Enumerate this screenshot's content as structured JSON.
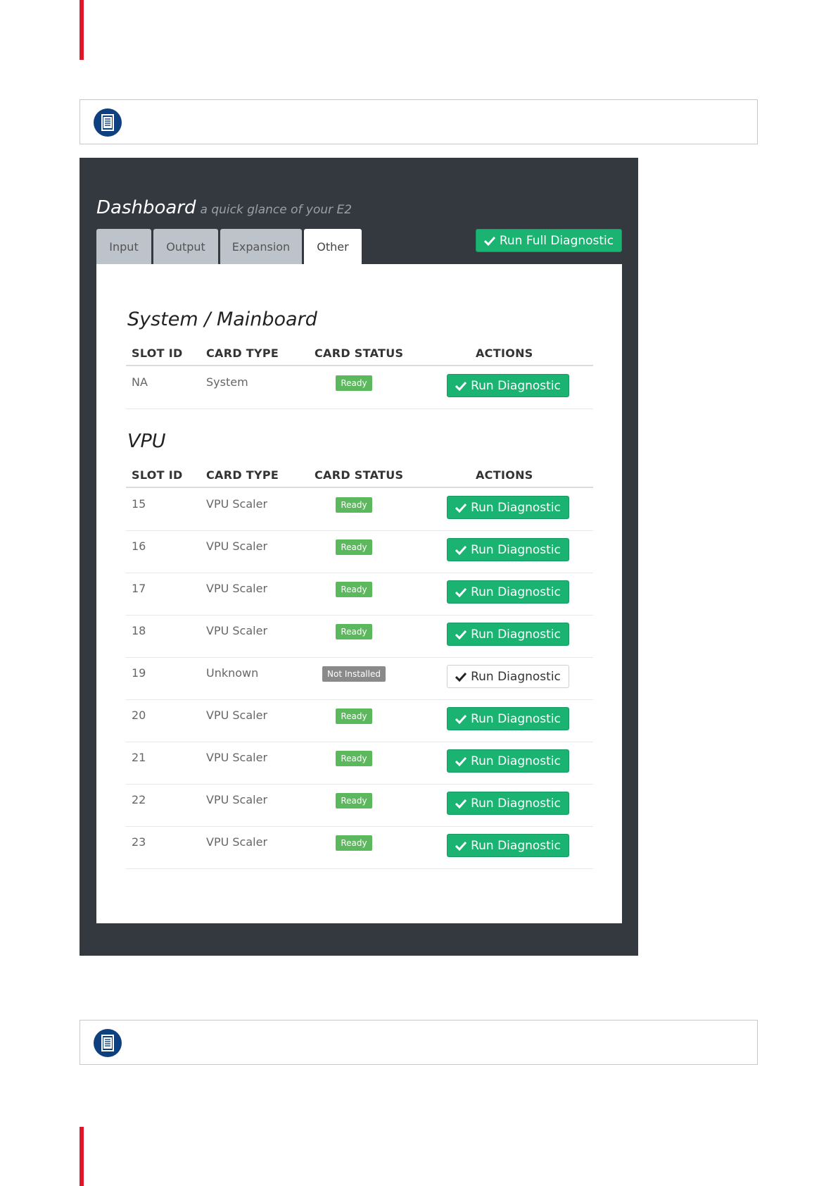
{
  "dashboard": {
    "title": "Dashboard",
    "subtitle": "a quick glance of your E2",
    "tabs": [
      "Input",
      "Output",
      "Expansion",
      "Other"
    ],
    "active_tab": "Other",
    "full_diagnostic_label": "Run Full Diagnostic"
  },
  "columns": {
    "slot_id": "SLOT ID",
    "card_type": "CARD TYPE",
    "card_status": "CARD STATUS",
    "actions": "ACTIONS"
  },
  "system": {
    "title": "System / Mainboard",
    "rows": [
      {
        "slot": "NA",
        "type": "System",
        "status": "Ready",
        "action": "Run Diagnostic"
      }
    ]
  },
  "vpu": {
    "title": "VPU",
    "rows": [
      {
        "slot": "15",
        "type": "VPU Scaler",
        "status": "Ready",
        "action": "Run Diagnostic"
      },
      {
        "slot": "16",
        "type": "VPU Scaler",
        "status": "Ready",
        "action": "Run Diagnostic"
      },
      {
        "slot": "17",
        "type": "VPU Scaler",
        "status": "Ready",
        "action": "Run Diagnostic"
      },
      {
        "slot": "18",
        "type": "VPU Scaler",
        "status": "Ready",
        "action": "Run Diagnostic"
      },
      {
        "slot": "19",
        "type": "Unknown",
        "status": "Not Installed",
        "action": "Run Diagnostic"
      },
      {
        "slot": "20",
        "type": "VPU Scaler",
        "status": "Ready",
        "action": "Run Diagnostic"
      },
      {
        "slot": "21",
        "type": "VPU Scaler",
        "status": "Ready",
        "action": "Run Diagnostic"
      },
      {
        "slot": "22",
        "type": "VPU Scaler",
        "status": "Ready",
        "action": "Run Diagnostic"
      },
      {
        "slot": "23",
        "type": "VPU Scaler",
        "status": "Ready",
        "action": "Run Diagnostic"
      }
    ]
  },
  "colors": {
    "accent_red": "#e0162b",
    "panel_dark": "#33393f",
    "success_green": "#1bb371",
    "ready_green": "#5cb85c",
    "note_icon_blue": "#0e3f7e"
  },
  "icons": {
    "note": "note-document-icon",
    "check": "checkmark-icon"
  }
}
